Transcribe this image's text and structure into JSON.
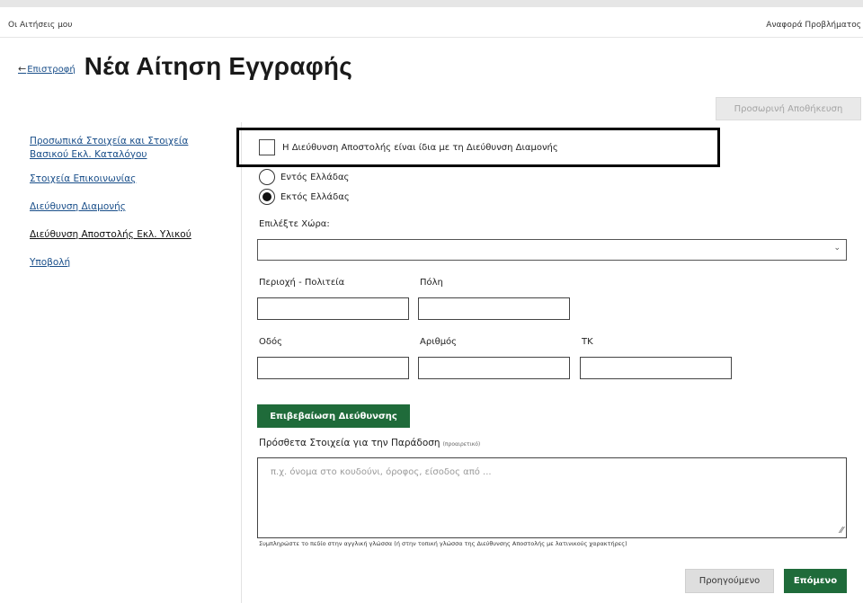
{
  "topbar": {
    "left_link": "Οι Αιτήσεις μου",
    "right_link": "Αναφορά Προβλήματος"
  },
  "header": {
    "back_arrow": "←",
    "back_label": "Επιστροφή",
    "title": "Νέα Αίτηση Εγγραφής"
  },
  "toolbar": {
    "temp_save_label": "Προσωρινή Αποθήκευση"
  },
  "sidebar": {
    "items": [
      {
        "label": "Προσωπικά Στοιχεία και Στοιχεία Βασικού Εκλ. Καταλόγου"
      },
      {
        "label": "Στοιχεία Επικοινωνίας"
      },
      {
        "label": "Διεύθυνση Διαμονής"
      },
      {
        "label": "Διεύθυνση Αποστολής Εκλ. Υλικού",
        "active": true
      },
      {
        "label": "Υποβολή"
      }
    ]
  },
  "form": {
    "same_address_label": "Η Διεύθυνση Αποστολής είναι ίδια με τη Διεύθυνση Διαμονής",
    "same_address_checked": false,
    "radio_options": [
      {
        "label": "Εντός Ελλάδας",
        "selected": false
      },
      {
        "label": "Εκτός Ελλάδας",
        "selected": true
      }
    ],
    "country_label": "Επιλέξτε Χώρα:",
    "country_value": "",
    "chevron": "⌄",
    "region_label": "Περιοχή - Πολιτεία",
    "city_label": "Πόλη",
    "street_label": "Οδός",
    "number_label": "Αριθμός",
    "postal_label": "ΤΚ",
    "confirm_button": "Επιβεβαίωση Διεύθυνσης",
    "notes_label": "Πρόσθετα Στοιχεία για την Παράδοση",
    "notes_optional": "(προαιρετικό)",
    "notes_placeholder": "π.χ. όνομα στο κουδούνι, όροφος, είσοδος από ...",
    "notes_hint": "Συμπληρώστε το πεδίο στην αγγλική γλώσσα (ή στην τοπική γλώσσα της Διεύθυνσης Αποστολής με λατινικούς χαρακτήρες)",
    "grip": "⁄⁄"
  },
  "footer": {
    "prev_label": "Προηγούμενο",
    "next_label": "Επόμενο"
  },
  "colors": {
    "primary_green": "#1f6b3a",
    "link_blue": "#1a4f8a",
    "disabled_gray": "#e9e9e9"
  }
}
